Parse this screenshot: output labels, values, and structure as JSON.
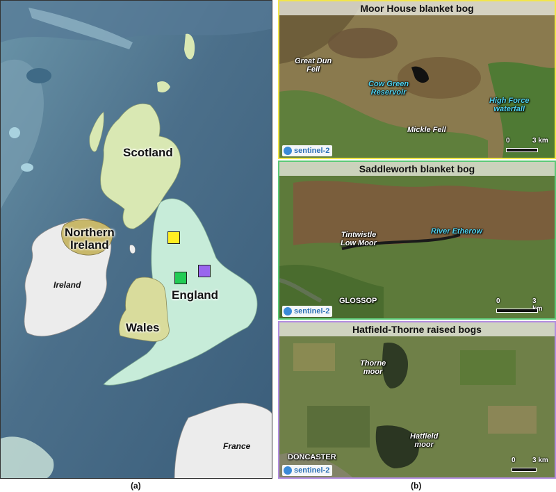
{
  "map": {
    "labels": {
      "scotland": "Scotland",
      "northern_ireland": "Northern\nIreland",
      "ireland": "Ireland",
      "wales": "Wales",
      "england": "England",
      "france": "France"
    },
    "markers": [
      {
        "site": "Moor House blanket bog",
        "color": "#ffee22"
      },
      {
        "site": "Saddleworth blanket bog",
        "color": "#22cc55"
      },
      {
        "site": "Hatfield-Thorne raised bogs",
        "color": "#9966ee"
      }
    ],
    "colors": {
      "sea_deep": "#3d5f7e",
      "sea_shelf": "#5a7f95",
      "land_uk": "#c7ecd9",
      "scotland": "#d9e8b3",
      "ireland_land": "#eeeeee",
      "northern_ireland": "#c8b86a",
      "wales": "#d9dc9c"
    }
  },
  "panels": [
    {
      "title": "Moor House blanket bog",
      "border_color": "#f2e64a",
      "places": [
        {
          "text": "Great Dun\nFell",
          "kind": "place"
        },
        {
          "text": "Cow Green\nReservoir",
          "kind": "water"
        },
        {
          "text": "High Force\nwaterfall",
          "kind": "water"
        },
        {
          "text": "Mickle Fell",
          "kind": "place"
        }
      ],
      "scale": {
        "start": "0",
        "end": "3 km"
      },
      "badge": "sentinel-2"
    },
    {
      "title": "Saddleworth blanket bog",
      "border_color": "#5cc977",
      "places": [
        {
          "text": "Tintwistle\nLow Moor",
          "kind": "place"
        },
        {
          "text": "River Etherow",
          "kind": "water"
        },
        {
          "text": "GLOSSOP",
          "kind": "town"
        }
      ],
      "scale": {
        "start": "0",
        "end": "3 km"
      },
      "badge": "sentinel-2"
    },
    {
      "title": "Hatfield-Thorne raised bogs",
      "border_color": "#b38de0",
      "places": [
        {
          "text": "Thorne\nmoor",
          "kind": "place"
        },
        {
          "text": "Hatfield\nmoor",
          "kind": "place"
        },
        {
          "text": "DONCASTER",
          "kind": "town"
        }
      ],
      "scale": {
        "start": "0",
        "end": "3 km"
      },
      "badge": "sentinel-2"
    }
  ],
  "captions": {
    "left": "(a)",
    "right": "(b)"
  }
}
